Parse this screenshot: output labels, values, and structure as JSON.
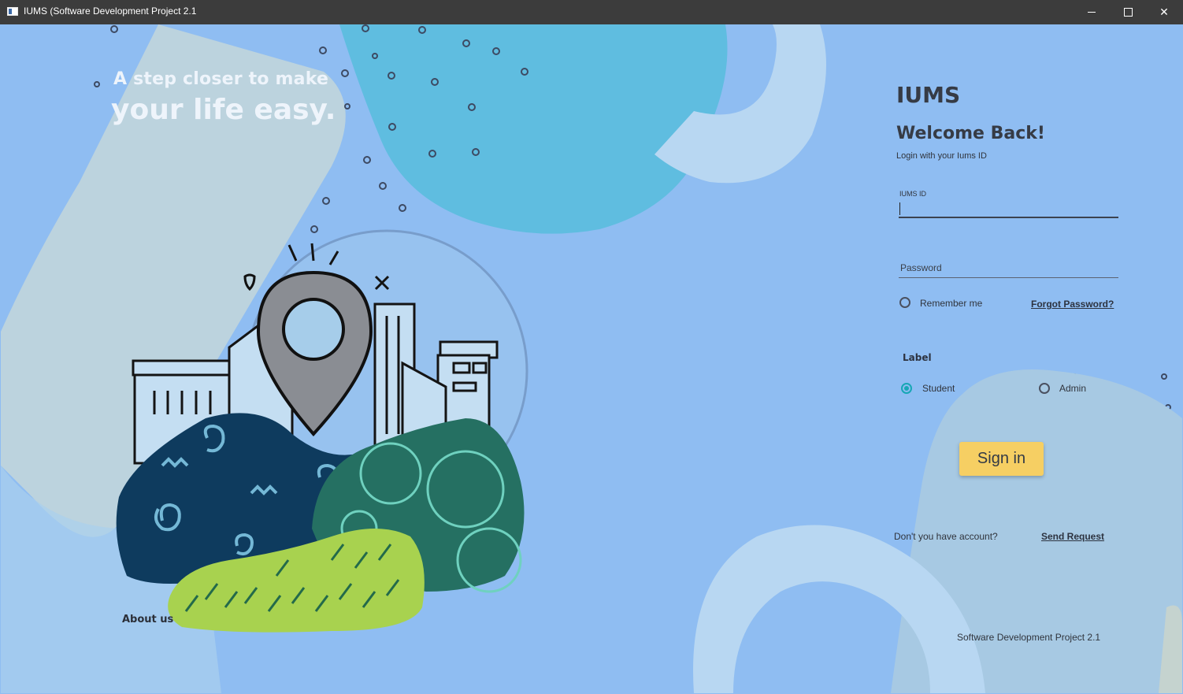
{
  "window": {
    "title": "IUMS (Software Development Project 2.1",
    "controls": {
      "minimize": "minimize-icon",
      "maximize": "maximize-icon",
      "close": "close-icon"
    }
  },
  "hero": {
    "tagline_line1": "A step closer to make",
    "tagline_line2": "your life easy.",
    "about_link": "About us"
  },
  "login": {
    "app_name": "IUMS",
    "welcome": "Welcome Back!",
    "subtitle": "Login with your Iums ID",
    "id_field": {
      "label": "IUMS ID",
      "value": ""
    },
    "password_field": {
      "placeholder": "Password",
      "value": ""
    },
    "remember_me": {
      "label": "Remember me",
      "checked": false
    },
    "forgot_password": "Forgot Password?",
    "role_group": {
      "heading": "Label",
      "options": [
        {
          "label": "Student",
          "selected": true
        },
        {
          "label": "Admin",
          "selected": false
        }
      ]
    },
    "sign_in": "Sign in",
    "no_account_text": "Don't you have account?",
    "send_request": "Send Request"
  },
  "footer": {
    "text": "Software Development Project 2.1"
  },
  "colors": {
    "background": "#8fbdf2",
    "accent_radio": "#18a7b5",
    "sign_in_button": "#f6cf63",
    "titlebar": "#3c3c3c"
  }
}
